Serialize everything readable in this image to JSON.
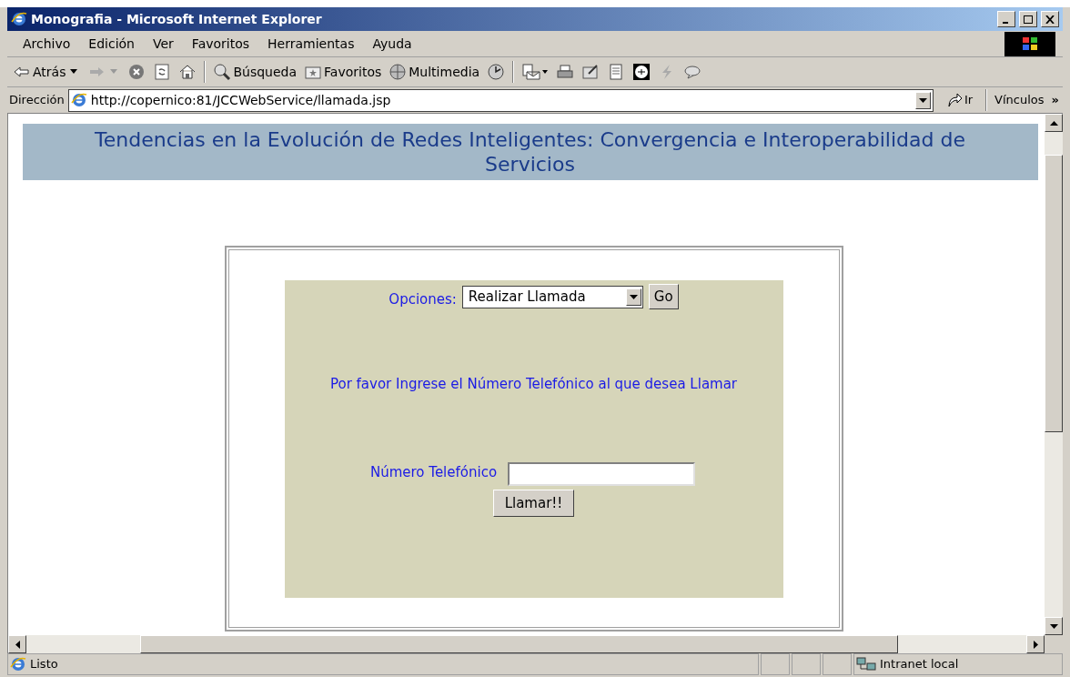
{
  "window": {
    "title": "Monografia - Microsoft Internet Explorer"
  },
  "menu": [
    "Archivo",
    "Edición",
    "Ver",
    "Favoritos",
    "Herramientas",
    "Ayuda"
  ],
  "toolbar": [
    {
      "kind": "back",
      "label": "Atrás"
    },
    {
      "kind": "forward"
    },
    {
      "kind": "stop"
    },
    {
      "kind": "refresh"
    },
    {
      "kind": "home"
    },
    {
      "kind": "separator"
    },
    {
      "kind": "search",
      "label": "Búsqueda"
    },
    {
      "kind": "favorites",
      "label": "Favoritos"
    },
    {
      "kind": "media",
      "label": "Multimedia"
    },
    {
      "kind": "history"
    },
    {
      "kind": "separator"
    },
    {
      "kind": "mail"
    },
    {
      "kind": "print"
    },
    {
      "kind": "edit"
    },
    {
      "kind": "document"
    },
    {
      "kind": "spy"
    },
    {
      "kind": "lightning"
    },
    {
      "kind": "messenger"
    }
  ],
  "address": {
    "label": "Dirección",
    "url": "http://copernico:81/JCCWebService/llamada.jsp",
    "go": "Ir",
    "links": "Vínculos",
    "more": "»"
  },
  "page": {
    "heading": "Tendencias en la Evolución de Redes Inteligentes: Convergencia e Interoperabilidad de Servicios",
    "options_label": "Opciones:",
    "options_value": "Realizar Llamada",
    "go_button": "Go",
    "prompt": "Por favor Ingrese el Número Telefónico al que desea Llamar",
    "phone_label": "Número Telefónico",
    "call_button": "Llamar!!"
  },
  "status_bar": {
    "text": "Listo",
    "zone": "Intranet local"
  }
}
